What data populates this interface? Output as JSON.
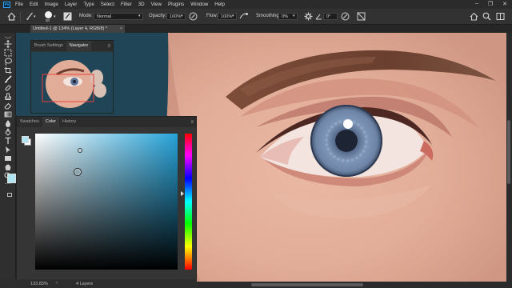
{
  "menubar": {
    "logo": "Ps",
    "items": [
      "File",
      "Edit",
      "Image",
      "Layer",
      "Type",
      "Select",
      "Filter",
      "3D",
      "View",
      "Plugins",
      "Window",
      "Help"
    ]
  },
  "optionsbar": {
    "brush_size": "50",
    "mode_label": "Mode:",
    "mode_value": "Normal",
    "opacity_label": "Opacity:",
    "opacity_value": "100%",
    "flow_label": "Flow:",
    "flow_value": "100%",
    "smoothing_label": "Smoothing:",
    "smoothing_value": "0%",
    "angle_value": "0°"
  },
  "document": {
    "tab_title": "Untitled-1 @ 134% (Layer 4, RGB/8) *",
    "tab_close": "×"
  },
  "navigator_panel": {
    "tabs": [
      "Brush Settings",
      "Navigator"
    ],
    "active_tab": "Navigator"
  },
  "color_panel": {
    "tabs": [
      "Swatches",
      "Color",
      "History"
    ],
    "active_tab": "Color",
    "foreground_color": "#aee3f1",
    "background_color": "#ffffff"
  },
  "statusbar": {
    "zoom": "133.83%",
    "layers": "4 Layers"
  },
  "colors": {
    "canvas_bg": "#1f4556",
    "accent": "#31a8ff",
    "iris": "#6e86a8"
  }
}
